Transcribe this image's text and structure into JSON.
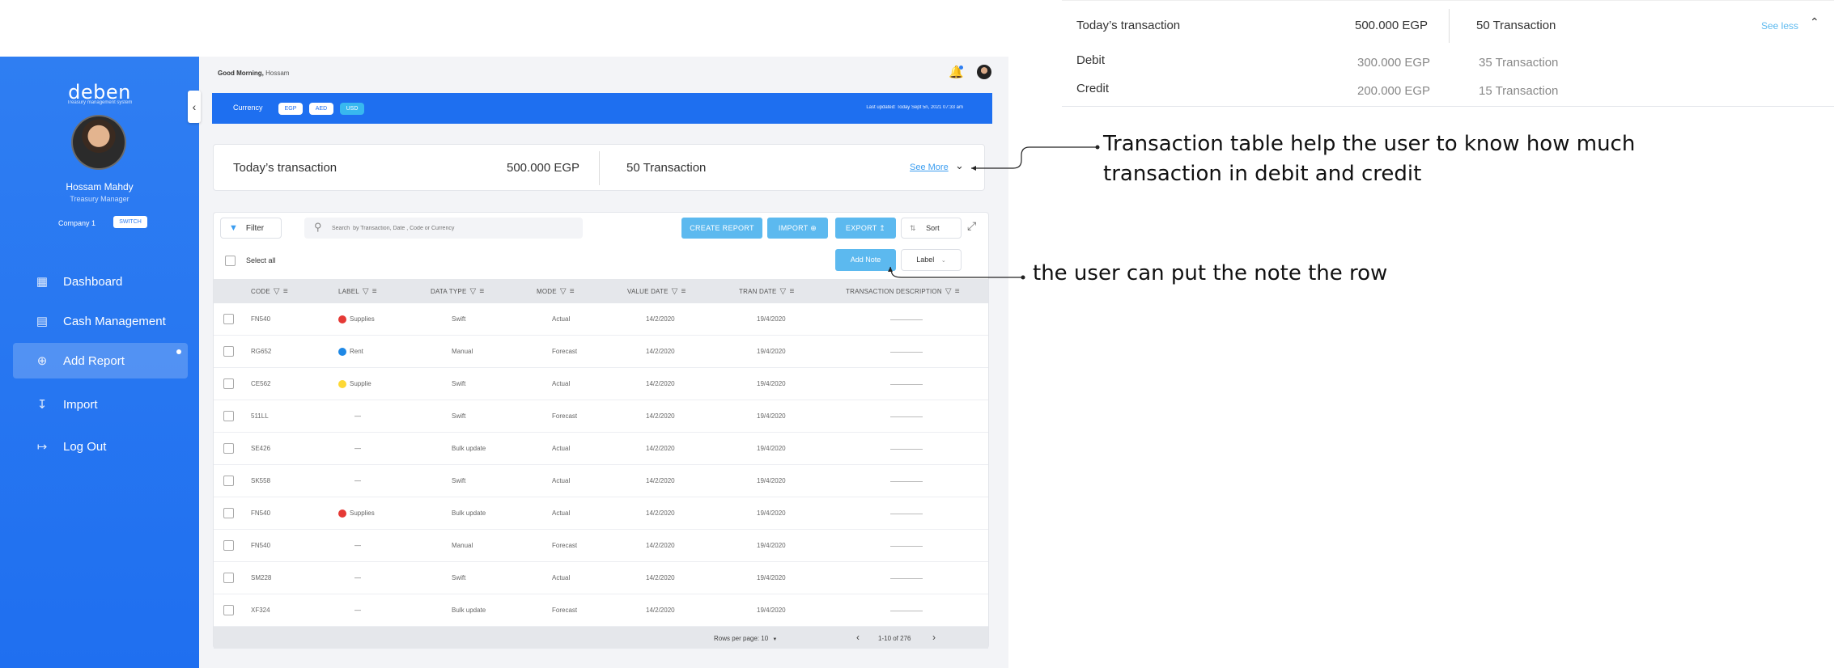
{
  "sidebar": {
    "logo": "deben",
    "logo_sub": "Treasury management system",
    "user_name": "Hossam Mahdy",
    "user_role": "Treasury Manager",
    "company": "Company 1",
    "switch_label": "SWITCH",
    "nav": [
      {
        "label": "Dashboard",
        "icon": "grid-icon"
      },
      {
        "label": "Cash Management",
        "icon": "cash-icon"
      },
      {
        "label": "Add Report",
        "icon": "plus-circle-icon"
      },
      {
        "label": "Import",
        "icon": "import-icon"
      },
      {
        "label": "Log Out",
        "icon": "logout-icon"
      }
    ]
  },
  "header": {
    "greeting_prefix": "Good Morning,",
    "greeting_name": "Hossam"
  },
  "currency_bar": {
    "label": "Currency",
    "options": [
      "EGP",
      "AED",
      "USD"
    ],
    "selected": "USD",
    "last_updated": "Last updated: Today    Sept 5n, 2021    07:33 am"
  },
  "summary": {
    "title": "Today’s transaction",
    "amount": "500.000 EGP",
    "count": "50 Transaction",
    "see_more": "See More"
  },
  "toolbar": {
    "filter": "Filter",
    "search_placeholder": "Search  by Transaction, Date , Code or Currency",
    "create_report": "CREATE REPORT",
    "import": "IMPORT",
    "export": "EXPORT",
    "sort": "Sort",
    "select_all": "Select all",
    "add_note": "Add Note",
    "label_dropdown": "Label"
  },
  "table": {
    "columns": [
      "CODE",
      "LABEL",
      "DATA TYPE",
      "MODE",
      "VALUE DATE",
      "TRAN DATE",
      "TRANSACTION DESCRIPTION"
    ],
    "rows": [
      {
        "code": "FN540",
        "label": "Supplies",
        "label_color": "#e53935",
        "data_type": "Swift",
        "mode": "Actual",
        "value_date": "14/2/2020",
        "tran_date": "19/4/2020"
      },
      {
        "code": "RG652",
        "label": "Rent",
        "label_color": "#1e88e5",
        "data_type": "Manual",
        "mode": "Forecast",
        "value_date": "14/2/2020",
        "tran_date": "19/4/2020"
      },
      {
        "code": "CE562",
        "label": "Supplie",
        "label_color": "#fdd835",
        "data_type": "Swift",
        "mode": "Actual",
        "value_date": "14/2/2020",
        "tran_date": "19/4/2020"
      },
      {
        "code": "511LL",
        "label": "",
        "label_color": "",
        "data_type": "Swift",
        "mode": "Forecast",
        "value_date": "14/2/2020",
        "tran_date": "19/4/2020"
      },
      {
        "code": "SE426",
        "label": "",
        "label_color": "",
        "data_type": "Bulk update",
        "mode": "Actual",
        "value_date": "14/2/2020",
        "tran_date": "19/4/2020"
      },
      {
        "code": "SK558",
        "label": "",
        "label_color": "",
        "data_type": "Swift",
        "mode": "Actual",
        "value_date": "14/2/2020",
        "tran_date": "19/4/2020"
      },
      {
        "code": "FN540",
        "label": "Supplies",
        "label_color": "#e53935",
        "data_type": "Bulk update",
        "mode": "Actual",
        "value_date": "14/2/2020",
        "tran_date": "19/4/2020"
      },
      {
        "code": "FN540",
        "label": "",
        "label_color": "",
        "data_type": "Manual",
        "mode": "Forecast",
        "value_date": "14/2/2020",
        "tran_date": "19/4/2020"
      },
      {
        "code": "SM228",
        "label": "",
        "label_color": "",
        "data_type": "Swift",
        "mode": "Actual",
        "value_date": "14/2/2020",
        "tran_date": "19/4/2020"
      },
      {
        "code": "XF324",
        "label": "",
        "label_color": "",
        "data_type": "Bulk update",
        "mode": "Forecast",
        "value_date": "14/2/2020",
        "tran_date": "19/4/2020"
      }
    ]
  },
  "pagination": {
    "rows_per_page": "Rows per page: 10",
    "range": "1-10 of 276"
  },
  "expanded_panel": {
    "title": "Today’s transaction",
    "amount": "500.000 EGP",
    "count": "50 Transaction",
    "see_less": "See less",
    "debit_label": "Debit",
    "debit_amount": "300.000 EGP",
    "debit_count": "35 Transaction",
    "credit_label": "Credit",
    "credit_amount": "200.000 EGP",
    "credit_count": "15 Transaction"
  },
  "annotations": {
    "transaction_table_line1": "Transaction table help the user to know how much",
    "transaction_table_line2": "transaction in debit and credit",
    "note": "the user can put the note the row"
  },
  "colors": {
    "sidebar": "#2f7ef2",
    "currency_bar": "#1e6ff0",
    "accent": "#5cb9ef"
  }
}
